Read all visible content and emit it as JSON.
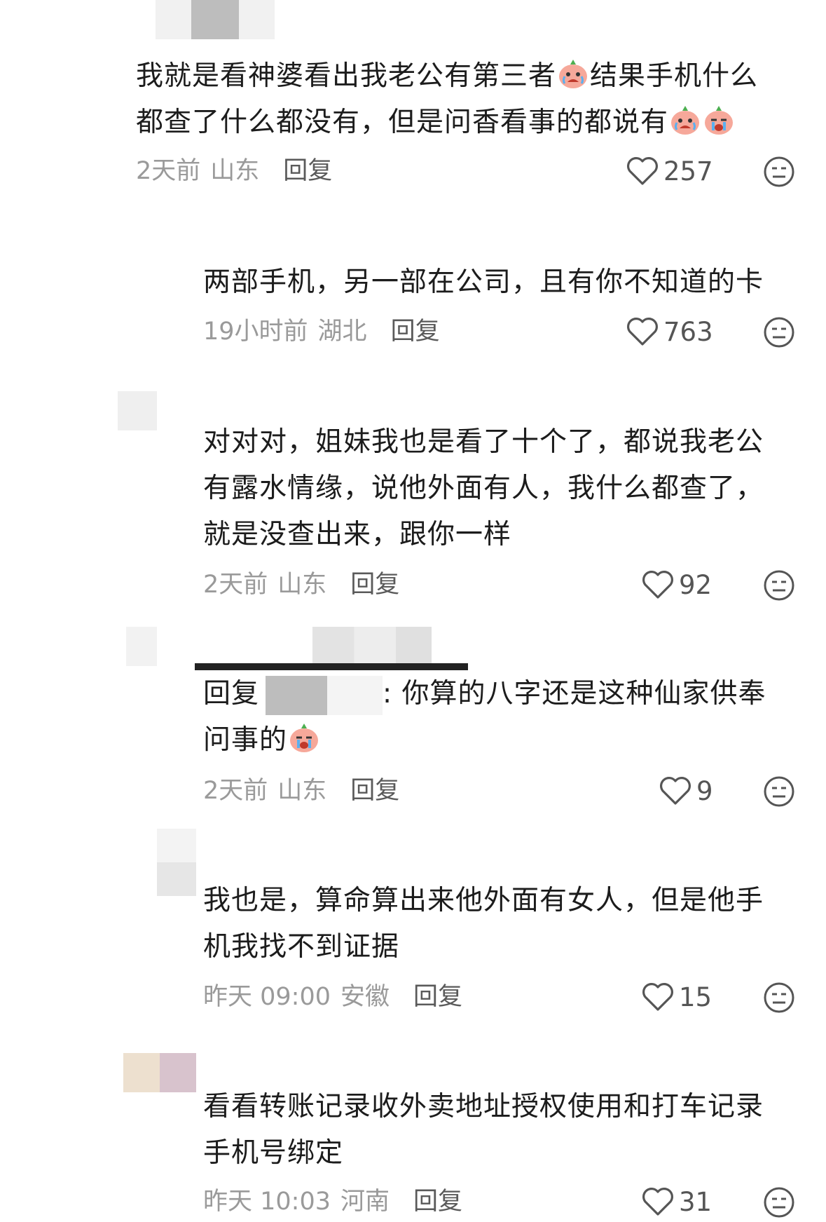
{
  "colors": {
    "text": "#1c1c1c",
    "meta": "#9a9a9a",
    "reply": "#5a5a5a",
    "icon": "#555555"
  },
  "comments": [
    {
      "lines": [
        "我就是看神婆看出我老公有第三者",
        "结果手机什么",
        "都查了什么都没有，但是问香看事的都说有"
      ],
      "time": "2天前",
      "location": "山东",
      "reply_label": "回复",
      "likes": "257"
    },
    {
      "lines": [
        "两部手机，另一部在公司，且有你不知道的卡"
      ],
      "time": "19小时前",
      "location": "湖北",
      "reply_label": "回复",
      "likes": "763"
    },
    {
      "lines": [
        "对对对，姐妹我也是看了十个了，都说我老公",
        "有露水情缘，说他外面有人，我什么都查了，",
        "就是没查出来，跟你一样"
      ],
      "time": "2天前",
      "location": "山东",
      "reply_label": "回复",
      "likes": "92"
    },
    {
      "reply_prefix": "回复",
      "lines": [
        ": 你算的八字还是这种仙家供奉",
        "问事的"
      ],
      "time": "2天前",
      "location": "山东",
      "reply_label": "回复",
      "likes": "9"
    },
    {
      "lines": [
        "我也是，算命算出来他外面有女人，但是他手",
        "机我找不到证据"
      ],
      "time": "昨天 09:00",
      "location": "安徽",
      "reply_label": "回复",
      "likes": "15"
    },
    {
      "lines": [
        "看看转账记录收外卖地址授权使用和打车记录",
        "手机号绑定"
      ],
      "time": "昨天 10:03",
      "location": "河南",
      "reply_label": "回复",
      "likes": "31"
    }
  ]
}
